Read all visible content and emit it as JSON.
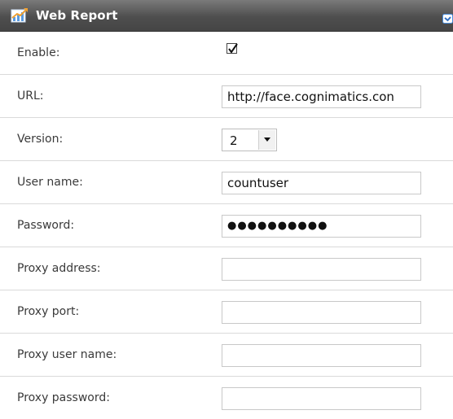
{
  "header": {
    "title": "Web Report",
    "app_icon": "chart-icon",
    "collapse_icon": "checkbox-collapse-icon",
    "accent": "#4a90e2"
  },
  "form": {
    "enable": {
      "label": "Enable:",
      "checked": true
    },
    "url": {
      "label": "URL:",
      "value": "http://face.cognimatics.con"
    },
    "version": {
      "label": "Version:",
      "value": "2"
    },
    "username": {
      "label": "User name:",
      "value": "countuser"
    },
    "password": {
      "label": "Password:",
      "value": "●●●●●●●●●●"
    },
    "proxy_address": {
      "label": "Proxy address:",
      "value": ""
    },
    "proxy_port": {
      "label": "Proxy port:",
      "value": ""
    },
    "proxy_username": {
      "label": "Proxy user name:",
      "value": ""
    },
    "proxy_password": {
      "label": "Proxy password:",
      "value": ""
    }
  }
}
